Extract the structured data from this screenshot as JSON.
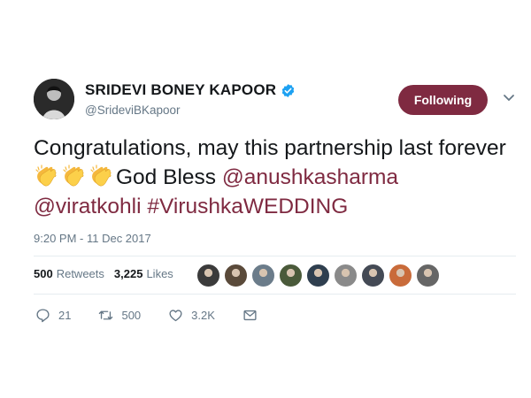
{
  "tweet": {
    "display_name": "SRIDEVI BONEY KAPOOR",
    "handle": "@SrideviBKapoor",
    "follow_label": "Following",
    "text_part1": "Congratulations, may this partnership last forever",
    "text_part2": "God Bless ",
    "mention1": "@anushkasharma",
    "mention2": "@viratkohli",
    "hashtag": "#VirushkaWEDDING",
    "timestamp": "9:20 PM - 11 Dec 2017"
  },
  "stats": {
    "retweets_count": "500",
    "retweets_label": "Retweets",
    "likes_count": "3,225",
    "likes_label": "Likes"
  },
  "actions": {
    "reply_count": "21",
    "retweet_count": "500",
    "like_count": "3.2K"
  },
  "icons": [
    "verified-badge-icon",
    "chevron-down-icon",
    "clapping-hands-icon",
    "reply-icon",
    "retweet-icon",
    "heart-icon",
    "direct-message-icon"
  ],
  "colors": {
    "accent": "#7f2a41",
    "verified": "#1da1f2",
    "muted": "#657786",
    "text": "#14171a"
  },
  "liker_avatar_colors": [
    "#3b3b3b",
    "#5a4a3a",
    "#6b7c8a",
    "#4a5a3a",
    "#2f3f4f",
    "#8a8a8a",
    "#444a55",
    "#c96b3a",
    "#666666"
  ]
}
